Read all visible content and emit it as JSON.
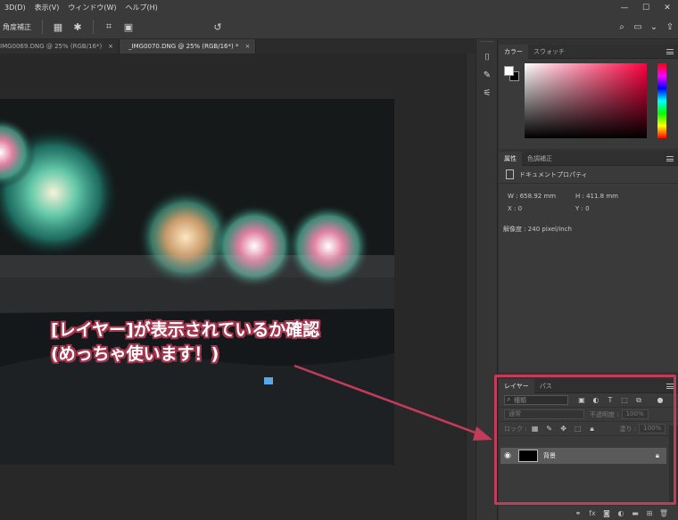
{
  "menubar": {
    "items": [
      "3D(D)",
      "表示(V)",
      "ウィンドウ(W)",
      "ヘルプ(H)"
    ],
    "window_controls": [
      "—",
      "☐",
      "✕"
    ]
  },
  "options_bar": {
    "label": "角度補正",
    "icons": [
      "grid-icon",
      "gear-icon",
      "crop-icon",
      "content-aware-icon",
      "reset-icon"
    ],
    "right_icons": [
      "search-icon",
      "workspace-icon",
      "share-icon"
    ]
  },
  "document_tabs": [
    {
      "title": "IMG0069.DNG @ 25% (RGB/16*)",
      "close": "×",
      "active": false
    },
    {
      "title": "_IMG0070.DNG @ 25% (RGB/16*) *",
      "close": "×",
      "active": true
    }
  ],
  "annotation": {
    "line1": "[レイヤー]が表示されているか確認",
    "line2": "(めっちゃ使います！)",
    "color": "#a6364f"
  },
  "color_panel": {
    "tabs": [
      "カラー",
      "スウォッチ"
    ],
    "foreground": "#ffffff",
    "background": "#000000",
    "hue": "#ff0040"
  },
  "properties_panel": {
    "tabs": [
      "属性",
      "色調補正"
    ],
    "section_title": "ドキュメントプロパティ",
    "w": "W :  658.92 mm",
    "h": "H :  411.8 mm",
    "x": "X :  0",
    "y": "Y :  0",
    "resolution": "解像度 : 240 pixel/inch"
  },
  "layers_panel": {
    "tabs": [
      "レイヤー",
      "パス"
    ],
    "filter_placeholder": "種類",
    "blend_mode": "通常",
    "opacity_label": "不透明度 :",
    "opacity_value": "100%",
    "lock_label": "ロック :",
    "fill_label": "塗り :",
    "fill_value": "100%",
    "layer": {
      "name": "背景",
      "visible": true,
      "locked": true
    },
    "bottom_icons": [
      "link-icon",
      "fx-icon",
      "mask-icon",
      "adjustment-icon",
      "folder-icon",
      "new-layer-icon",
      "trash-icon"
    ]
  },
  "highlight_color": "#c23c5a"
}
